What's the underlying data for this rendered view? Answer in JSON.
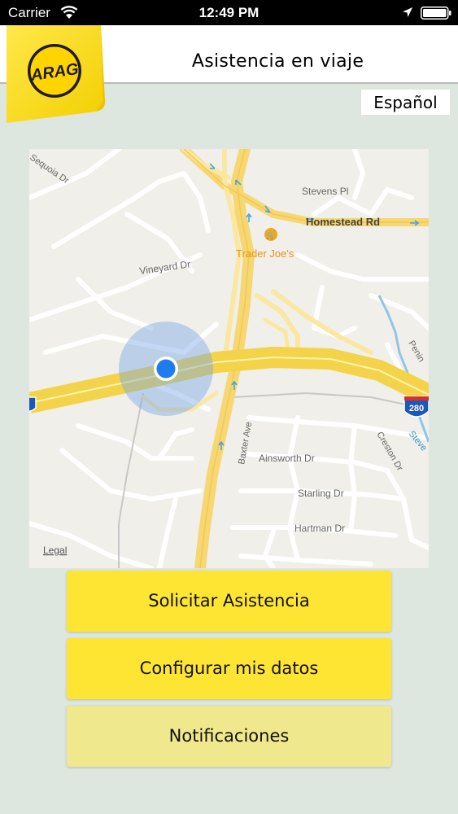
{
  "status_bar": {
    "carrier": "Carrier",
    "time": "12:49 PM"
  },
  "header": {
    "title": "Asistencia en viaje",
    "logo_text": "ARAG"
  },
  "language": {
    "label": "Español"
  },
  "map": {
    "streets": {
      "sequoia": "Sequoia Dr",
      "stevens_pl": "Stevens Pl",
      "homestead": "Homestead Rd",
      "vineyard": "Vineyard Dr",
      "baxter": "Baxter Ave",
      "ainsworth": "Ainsworth Dr",
      "starling": "Starling Dr",
      "hartman": "Hartman Dr",
      "creston": "Creston Dr",
      "penin": "Penin",
      "steve": "Steve"
    },
    "poi": "Trader Joe's",
    "highway_shield": "280",
    "legal": "Legal"
  },
  "buttons": {
    "request": "Solicitar Asistencia",
    "configure": "Configurar mis datos",
    "notifications": "Notificaciones"
  },
  "colors": {
    "button_primary": "#fee533",
    "button_secondary": "#efe88c",
    "background": "#dde6df",
    "location_dot": "#1f7cf0"
  }
}
